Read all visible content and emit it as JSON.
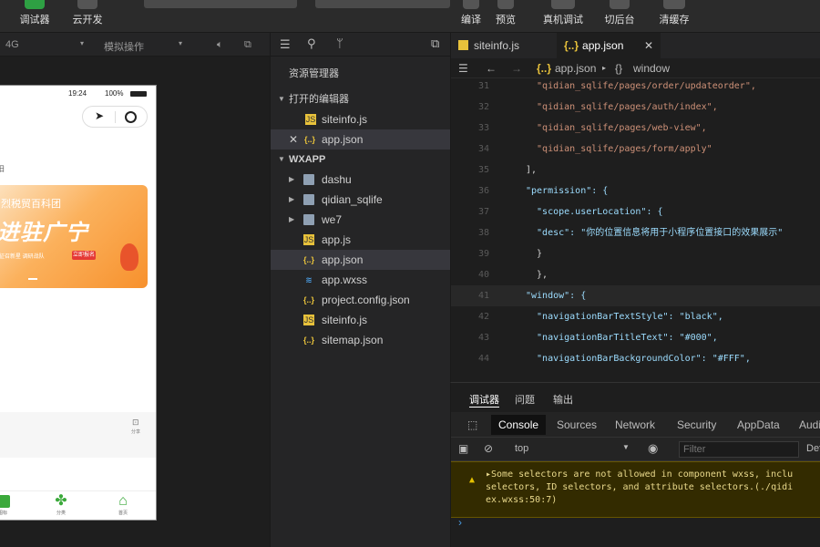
{
  "toolbar": {
    "debugger_label": "调试器",
    "cloud_label": "云开发",
    "compile_label": "编译",
    "preview_label": "预览",
    "remote_debug_label": "真机调试",
    "background_label": "切后台",
    "clear_cache_label": "清缓存"
  },
  "device_bar": {
    "network": "4G",
    "simulate_op": "模拟操作"
  },
  "phone": {
    "time": "19:24",
    "battery": "100%",
    "banner": {
      "line1": "烈税贸百科团",
      "line2": "进驻广宁",
      "line3": "征召新星 调研战队",
      "chip": "立即报名"
    },
    "side_action": "分享",
    "tabs": [
      "图标",
      "分类",
      "首页"
    ]
  },
  "explorer": {
    "title": "资源管理器",
    "open_editors_label": "打开的编辑器",
    "open_editors": [
      {
        "name": "siteinfo.js",
        "type": "js"
      },
      {
        "name": "app.json",
        "type": "json"
      }
    ],
    "project_label": "WXAPP",
    "tree": [
      {
        "name": "dashu",
        "type": "folder"
      },
      {
        "name": "qidian_sqlife",
        "type": "folder"
      },
      {
        "name": "we7",
        "type": "folder"
      },
      {
        "name": "app.js",
        "type": "js"
      },
      {
        "name": "app.json",
        "type": "json"
      },
      {
        "name": "app.wxss",
        "type": "wxss"
      },
      {
        "name": "project.config.json",
        "type": "json"
      },
      {
        "name": "siteinfo.js",
        "type": "js"
      },
      {
        "name": "sitemap.json",
        "type": "json"
      }
    ]
  },
  "editor": {
    "tabs": [
      {
        "name": "siteinfo.js"
      },
      {
        "name": "app.json"
      }
    ],
    "breadcrumb_file": "app.json",
    "breadcrumb_symbol": "window",
    "lines": [
      {
        "n": "31",
        "text": "  \"qidian_sqlife/pages/order/updateorder\","
      },
      {
        "n": "32",
        "text": "  \"qidian_sqlife/pages/auth/index\","
      },
      {
        "n": "33",
        "text": "  \"qidian_sqlife/pages/web-view\","
      },
      {
        "n": "34",
        "text": "  \"qidian_sqlife/pages/form/apply\""
      },
      {
        "n": "35",
        "text": "],"
      },
      {
        "n": "36",
        "text": "\"permission\": {"
      },
      {
        "n": "37",
        "text": "  \"scope.userLocation\": {"
      },
      {
        "n": "38",
        "text": "  \"desc\": \"你的位置信息将用于小程序位置接口的效果展示\""
      },
      {
        "n": "39",
        "text": "  }"
      },
      {
        "n": "40",
        "text": "  },"
      },
      {
        "n": "41",
        "text": "\"window\": {"
      },
      {
        "n": "42",
        "text": "  \"navigationBarTextStyle\": \"black\","
      },
      {
        "n": "43",
        "text": "  \"navigationBarTitleText\": \"#000\","
      },
      {
        "n": "44",
        "text": "  \"navigationBarBackgroundColor\": \"#FFF\","
      }
    ]
  },
  "debugger": {
    "panel_tabs": [
      "调试器",
      "问题",
      "输出"
    ],
    "dev_tabs": [
      "Console",
      "Sources",
      "Network",
      "Security",
      "AppData",
      "Audi"
    ],
    "context": "top",
    "filter_placeholder": "Filter",
    "levels": "Def",
    "warning_lines": [
      "▸Some selectors are not allowed in component wxss, inclu",
      "selectors, ID selectors, and attribute selectors.(./qidi",
      "ex.wxss:50:7)"
    ],
    "prompt": "›"
  }
}
